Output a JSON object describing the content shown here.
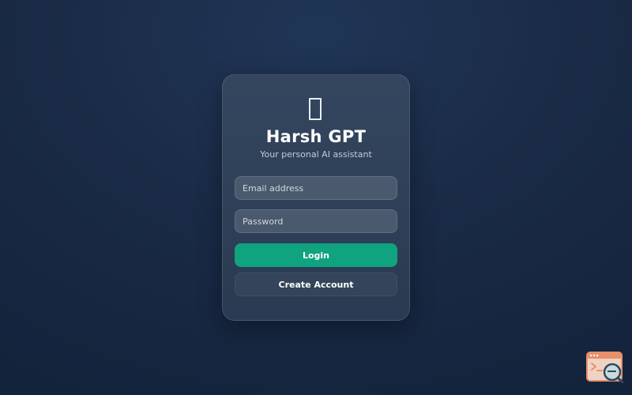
{
  "app": {
    "title": "Harsh GPT",
    "subtitle": "Your personal AI assistant",
    "logo_icon": "square-placeholder-icon"
  },
  "form": {
    "email_placeholder": "Email address",
    "password_placeholder": "Password",
    "login_label": "Login",
    "create_account_label": "Create Account"
  },
  "colors": {
    "background": "#1a2b47",
    "card": "#2f4058",
    "input": "#4a596d",
    "accent": "#10a37f",
    "secondary_button": "#34445a",
    "badge": "#e8906a"
  },
  "corner_badge": {
    "icon": "terminal-search-icon"
  }
}
